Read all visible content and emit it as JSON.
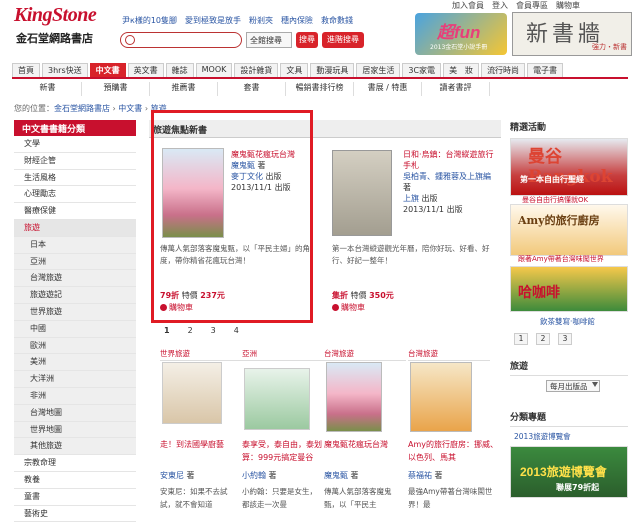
{
  "header": {
    "logo_en": "KingStone",
    "logo_zh": "金石堂網路書店",
    "promo_links": [
      "尹к樣的10隻腳",
      "愛到極致是放手",
      "粉剎夾",
      "穗內保險",
      "救命數錢"
    ],
    "utility": [
      "加入會員",
      "登入",
      "會員專區",
      "購物車"
    ],
    "search_placeholder": "",
    "search_scope": "全館搜尋",
    "search_btn": "搜尋",
    "adv_search_btn": "進階搜尋",
    "fun_banner": "超fun",
    "fun_sub": "2013金石堂小說手冊",
    "newbook_banner": "新書牆",
    "newbook_sub": "強力・新書"
  },
  "category_tabs": [
    "首頁",
    "3hrs快送",
    "中文書",
    "英文書",
    "雜誌",
    "MOOK",
    "設計雜貨",
    "文具",
    "動漫玩具",
    "居家生活",
    "3C家電",
    "美　妝",
    "流行時尚",
    "電子書"
  ],
  "sub_tabs": [
    "新書",
    "預購書",
    "推薦書",
    "套書",
    "暢銷書排行榜",
    "書展 / 特惠",
    "讀者書評"
  ],
  "breadcrumb": {
    "prefix": "您的位置：",
    "path": [
      "金石堂網路書店",
      "中文書",
      "旅遊"
    ]
  },
  "sidebar": {
    "title": "中文書書籍分類",
    "items": [
      "文學",
      "財經企管",
      "生活風格",
      "心理勵志",
      "醫療保健",
      "旅遊",
      "日本",
      "亞洲",
      "台灣旅遊",
      "旅遊遊記",
      "世界旅遊",
      "中國",
      "歐洲",
      "美洲",
      "大洋洲",
      "非洲",
      "台灣地圖",
      "世界地圖",
      "其他旅遊",
      "宗教命理",
      "教養",
      "童書",
      "藝術史"
    ]
  },
  "main": {
    "title": "旅遊焦點新書",
    "featured": [
      {
        "title": "魔鬼甄花瘋玩台灣",
        "author": "魔鬼甄",
        "author_suffix": "著",
        "publisher": "麥丁文化",
        "publisher_suffix": "出版",
        "date": "2013/11/1",
        "date_suffix": "出版",
        "desc": "傳萬人氣部落客魔鬼甄，以「平民主婦」的角度，帶你精省花瘋玩台灣！",
        "discount": "79折",
        "price_label": "特價",
        "price": "237元",
        "cart": "購物車"
      },
      {
        "title": "日和·烏鎮：台灣縱遊旅行手札",
        "author": "吳柏青、鍾雅蓉及上旗編",
        "author_suffix": "著",
        "publisher": "上旗",
        "publisher_suffix": "出版",
        "date": "2013/11/1",
        "date_suffix": "出版",
        "desc": "第一本台灣縱遊觀光年曆，陪你好玩、好看、好行、好記一整年！",
        "discount": "集折",
        "price_label": "特價",
        "price": "350元",
        "cart": "購物車"
      }
    ],
    "pager": [
      "1",
      "2",
      "3",
      "4"
    ],
    "grid": [
      {
        "tag": "世界旅遊",
        "title": "走！到法國學廚藝",
        "author": "安東尼",
        "author_suffix": "著",
        "desc": "安東尼：如果不去試試，就不會知道"
      },
      {
        "tag": "亞洲",
        "title": "泰享受，泰自由，泰划算：999元搞定曼谷",
        "author": "小約翰",
        "author_suffix": "著",
        "desc": "小約翰：只要是女生，都該走一次曼"
      },
      {
        "tag": "台灣旅遊",
        "title": "魔鬼甄花瘋玩台灣",
        "author": "魔鬼甄",
        "author_suffix": "著",
        "desc": "傳萬人氣部落客魔鬼甄，以「平民主"
      },
      {
        "tag": "台灣旅遊",
        "title": "Amy的旅行廚房：挪威、以色列、馬其",
        "author": "蔡福祐",
        "author_suffix": "著",
        "desc": "最強Amy帶著台灣味闖世界！最"
      }
    ]
  },
  "right": {
    "events_title": "精選活動",
    "banner1": "曼谷 Bangkok",
    "banner1_sub": "第一本自由行聖經",
    "banner1_cap": "曼谷自由行搞懂就OK",
    "banner2": "Amy的旅行廚房",
    "banner2_cap": "跟著Amy帶著台灣味闖世界",
    "banner3": "哈咖啡",
    "more": "飲茶雙寫·咖啡館",
    "pages": [
      "1",
      "2",
      "3"
    ],
    "travel_title": "旅遊",
    "travel_select": "每月出版品",
    "topics_title": "分類專題",
    "topic_link": "2013旅遊博覽會",
    "fair_banner": "2013旅遊博覽會",
    "fair_sub": "聯展79折起"
  }
}
